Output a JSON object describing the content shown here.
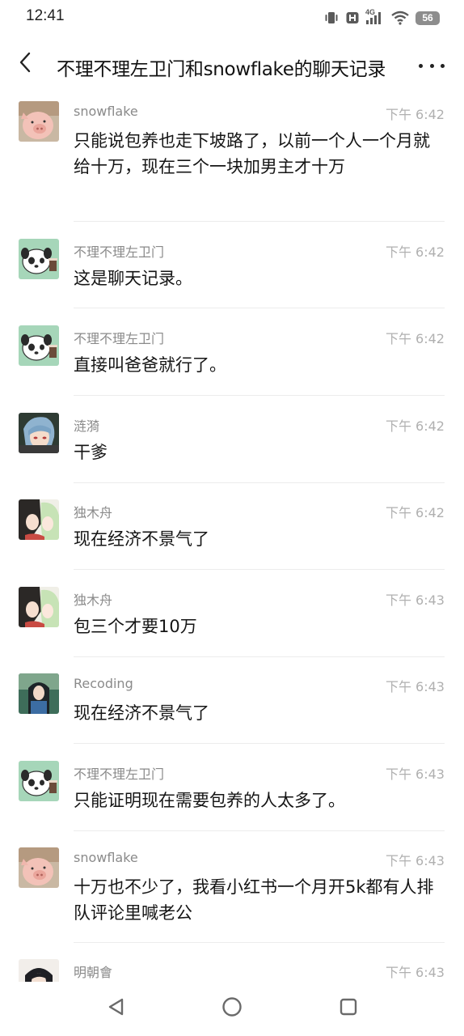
{
  "status_bar": {
    "time": "12:41",
    "network": "4G",
    "battery": "56",
    "icons": [
      "vibrate-icon",
      "hd-icon",
      "signal-icon",
      "wifi-icon",
      "battery-icon"
    ]
  },
  "header": {
    "title": "不理不理左卫门和snowflake的聊天记录",
    "back_icon": "chevron-left-icon",
    "more_icon": "more-dots-icon"
  },
  "messages": [
    {
      "sender": "snowflake",
      "time": "下午 6:42",
      "text": "只能说包养也走下坡路了，以前一个人一个月就给十万，现在三个一块加男主才十万",
      "avatar": "pig-avatar"
    },
    {
      "sender": "不理不理左卫门",
      "time": "下午 6:42",
      "text": "这是聊天记录。",
      "avatar": "panda-dog-avatar"
    },
    {
      "sender": "不理不理左卫门",
      "time": "下午 6:42",
      "text": "直接叫爸爸就行了。",
      "avatar": "panda-dog-avatar"
    },
    {
      "sender": "涟漪",
      "time": "下午 6:42",
      "text": "干爹",
      "avatar": "anime-blue-hair-avatar"
    },
    {
      "sender": "独木舟",
      "time": "下午 6:42",
      "text": "现在经济不景气了",
      "avatar": "anime-couple-avatar"
    },
    {
      "sender": "独木舟",
      "time": "下午 6:43",
      "text": "包三个才要10万",
      "avatar": "anime-couple-avatar"
    },
    {
      "sender": "Recoding",
      "time": "下午 6:43",
      "text": "现在经济不景气了",
      "avatar": "anime-girl-forest-avatar"
    },
    {
      "sender": "不理不理左卫门",
      "time": "下午 6:43",
      "text": "只能证明现在需要包养的人太多了。",
      "avatar": "panda-dog-avatar"
    },
    {
      "sender": "snowflake",
      "time": "下午 6:43",
      "text": "十万也不少了，我看小红书一个月开5k都有人排队评论里喊老公",
      "avatar": "pig-avatar"
    },
    {
      "sender": "明朝會",
      "time": "下午 6:43",
      "text": "",
      "avatar": "anime-dark-hair-avatar"
    }
  ],
  "nav_bar": {
    "icons": [
      "back-triangle-icon",
      "home-circle-icon",
      "recents-square-icon"
    ]
  },
  "colors": {
    "background": "#ffffff",
    "text_primary": "#151515",
    "sender": "#8a8a8a",
    "time": "#b0b0b0",
    "divider": "#ececec"
  }
}
